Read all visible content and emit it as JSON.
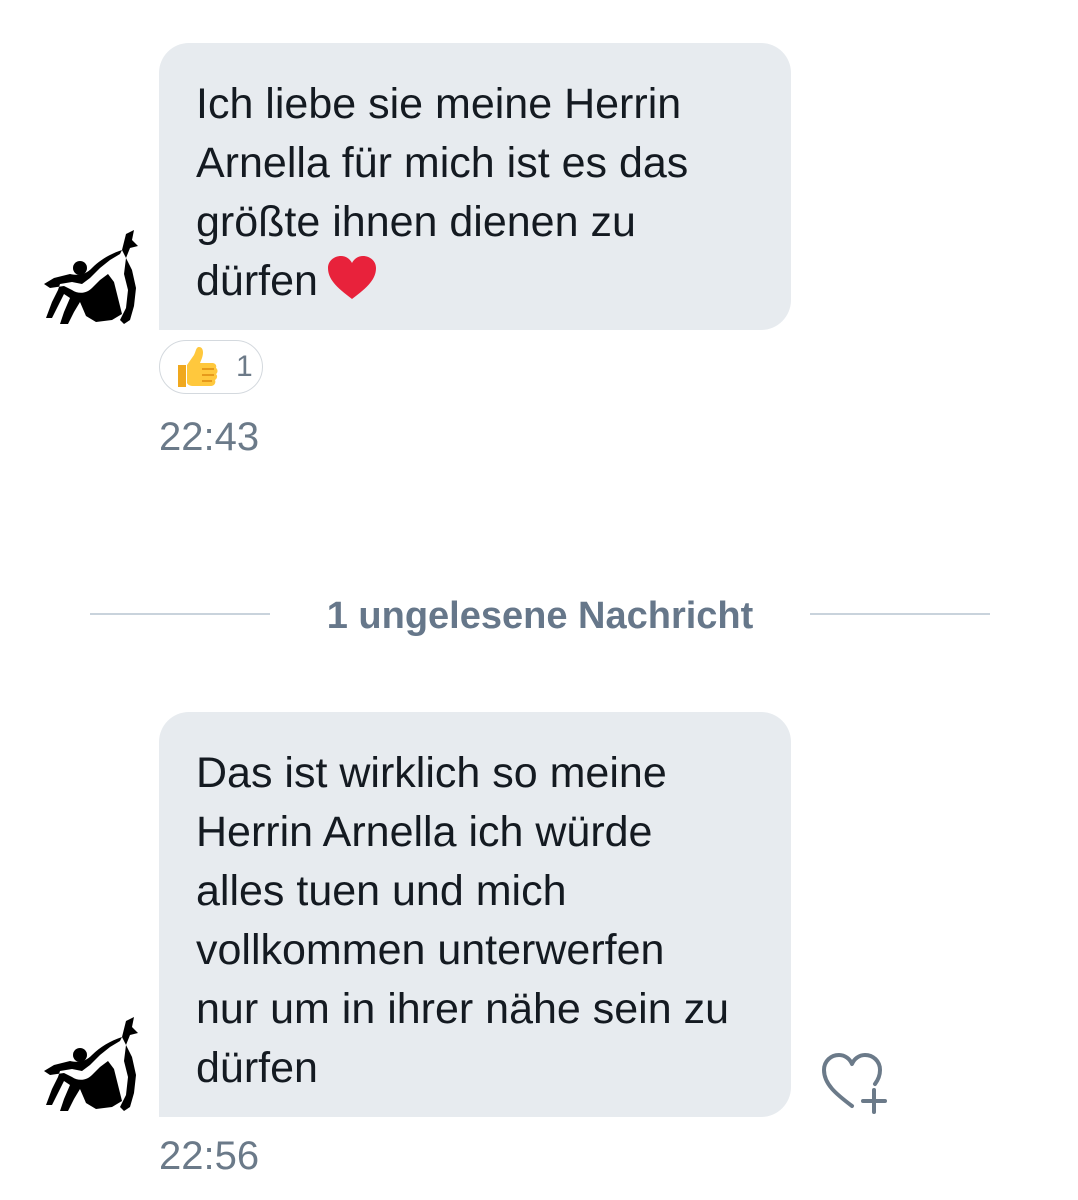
{
  "messages": [
    {
      "text": "Ich liebe sie meine Herrin\nArnella für mich ist es das\ngrößte ihnen dienen zu\ndürfen",
      "emoji": "red-heart",
      "reaction": {
        "emoji": "thumbs-up",
        "count": "1"
      },
      "time": "22:43"
    },
    {
      "text": "Das ist wirklich so meine\nHerrin Arnella ich würde\nalles tuen und mich\nvollkommen unterwerfen\nnur um in ihrer nähe sein zu\ndürfen",
      "time": "22:56"
    }
  ],
  "divider": {
    "label": "1 ungelesene Nachricht"
  },
  "icons": {
    "avatar": "kneeling-figures-avatar",
    "reaction": "thumbs-up-icon",
    "add_reaction": "heart-plus-icon"
  },
  "colors": {
    "bubble": "#e7ebef",
    "text": "#141a21",
    "meta": "#6b7a89",
    "divider_line": "#c9d3dc",
    "heart": "#e8223b"
  }
}
